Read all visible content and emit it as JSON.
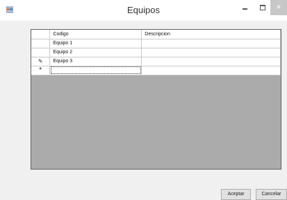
{
  "window": {
    "title": "Equipos",
    "close_glyph": "×"
  },
  "icons": {
    "app": "app-icon",
    "minimize": "minimize-icon",
    "maximize": "maximize-icon",
    "close": "close-icon",
    "edit_row": "pencil-icon",
    "new_row": "asterisk-icon"
  },
  "grid": {
    "columns": [
      "Codigo",
      "Descripcion"
    ],
    "rows": [
      {
        "codigo": "Equipo 1",
        "descripcion": ""
      },
      {
        "codigo": "Equipo 2",
        "descripcion": ""
      },
      {
        "codigo": "Equipo 3",
        "descripcion": ""
      },
      {
        "codigo": "",
        "descripcion": ""
      }
    ],
    "edit_marker": "✎",
    "new_marker": "*"
  },
  "buttons": {
    "accept": "Aceptar",
    "cancel": "Cancelar"
  },
  "colors": {
    "grid_background": "#ababab",
    "window_background": "#f0f0f0"
  }
}
